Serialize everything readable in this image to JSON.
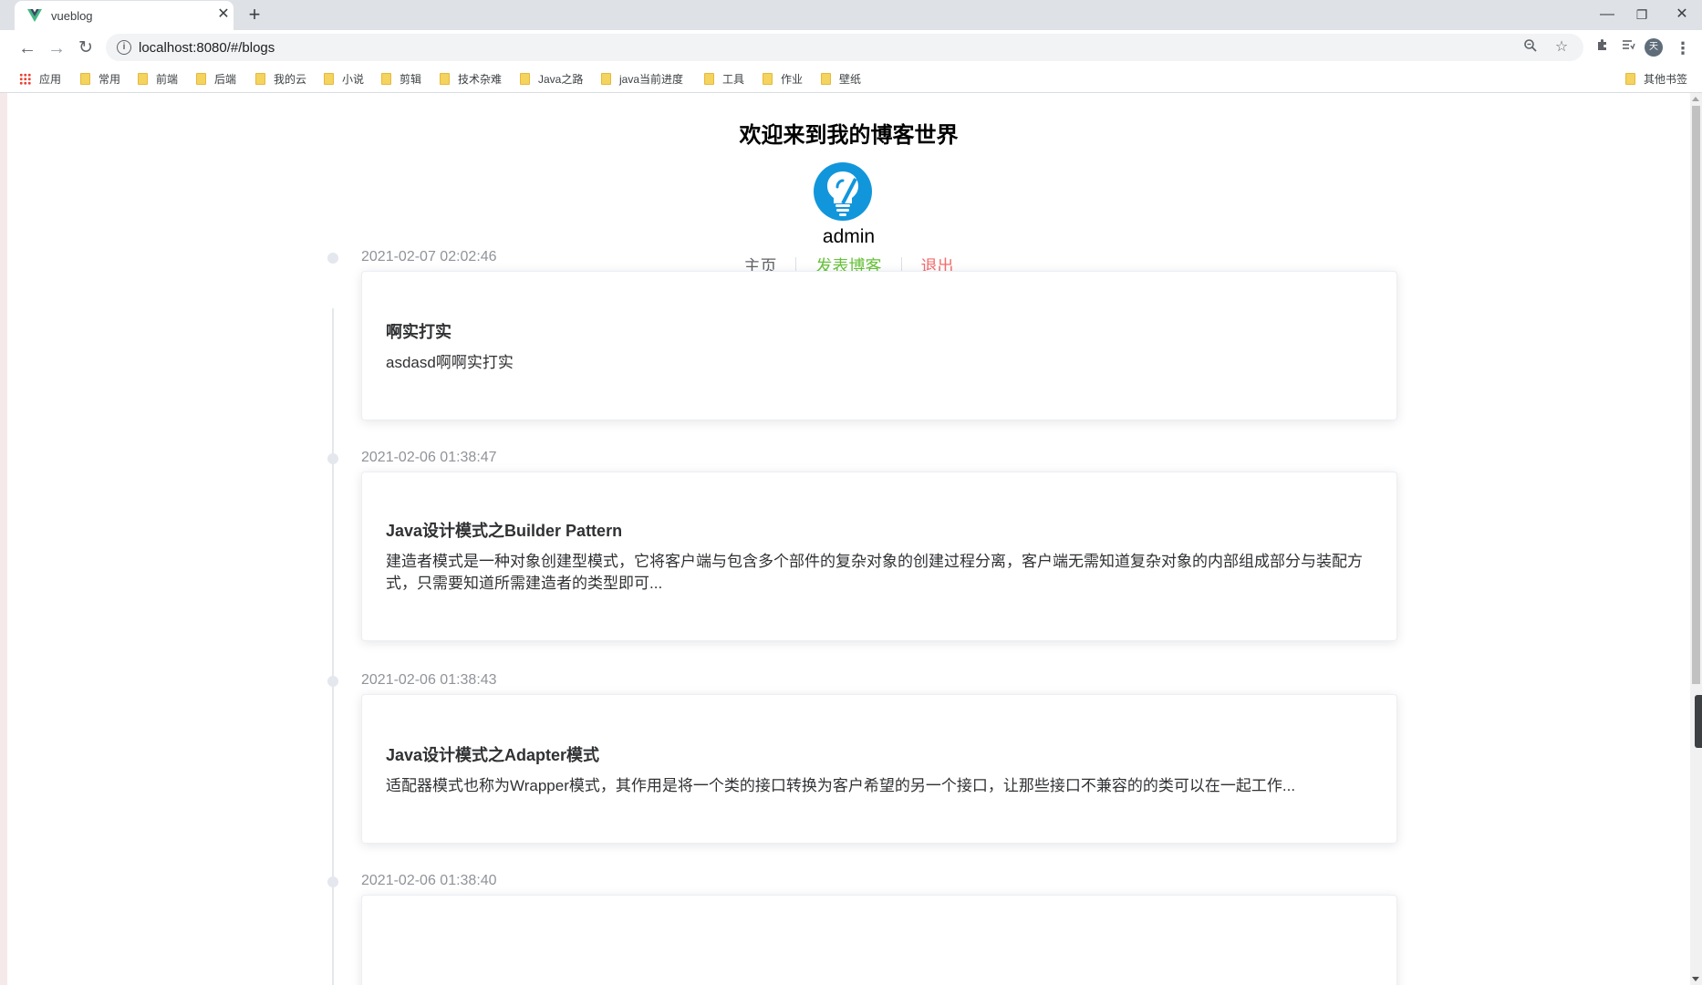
{
  "browser": {
    "tab_title": "vueblog",
    "tab_close": "✕",
    "new_tab": "+",
    "url": "localhost:8080/#/blogs",
    "window_controls": {
      "minimize": "—",
      "restore": "❐",
      "close": "✕"
    },
    "icons": [
      "back-icon",
      "forward-icon",
      "reload-icon",
      "site-info-icon",
      "zoom-icon",
      "star-icon",
      "extensions-icon",
      "reading-list-icon",
      "profile-avatar",
      "menu-icon"
    ],
    "profile_initial": "天"
  },
  "bookmarks": {
    "apps": "应用",
    "items": [
      "常用",
      "前端",
      "后端",
      "我的云",
      "小说",
      "剪辑",
      "技术杂难",
      "Java之路",
      "java当前进度",
      "工具",
      "作业",
      "壁纸"
    ],
    "other": "其他书签"
  },
  "header": {
    "title": "欢迎来到我的博客世界",
    "username": "admin",
    "nav": {
      "home": "主页",
      "post": "发表博客",
      "logout": "退出"
    },
    "colors": {
      "avatar": "#1296db",
      "post": "#67c23a",
      "logout": "#f56c6c"
    }
  },
  "blogs": [
    {
      "time": "2021-02-07 02:02:46",
      "title": "啊实打实",
      "description": "asdasd啊啊实打实"
    },
    {
      "time": "2021-02-06 01:38:47",
      "title": "Java设计模式之Builder Pattern",
      "description": "建造者模式是一种对象创建型模式，它将客户端与包含多个部件的复杂对象的创建过程分离，客户端无需知道复杂对象的内部组成部分与装配方式，只需要知道所需建造者的类型即可..."
    },
    {
      "time": "2021-02-06 01:38:43",
      "title": "Java设计模式之Adapter模式",
      "description": "适配器模式也称为Wrapper模式，其作用是将一个类的接口转换为客户希望的另一个接口，让那些接口不兼容的的类可以在一起工作..."
    },
    {
      "time": "2021-02-06 01:38:40",
      "title": "",
      "description": ""
    }
  ]
}
